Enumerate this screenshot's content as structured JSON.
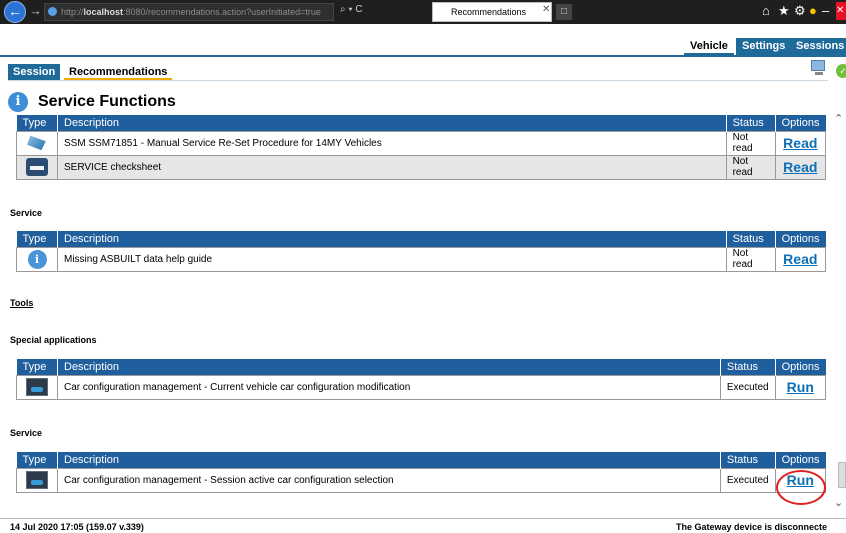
{
  "browser": {
    "url_host": "localhost",
    "url_rest": ":8080/recommendations.action?userInitiated=true",
    "url_prefix": "http://",
    "tab_title": "Recommendations"
  },
  "topnav": {
    "vehicle": "Vehicle",
    "settings": "Settings",
    "sessions": "Sessions"
  },
  "subtabs": {
    "session": "Session",
    "recommendations": "Recommendations"
  },
  "page_title": "Service Functions",
  "table_headers": {
    "type": "Type",
    "description": "Description",
    "status": "Status",
    "options": "Options"
  },
  "sections": {
    "service_functions": {
      "rows": [
        {
          "icon": "ssm-icon",
          "description": "SSM SSM71851 - Manual Service Re-Set Procedure for 14MY Vehicles",
          "status": "Not read",
          "option": "Read"
        },
        {
          "icon": "service-checksheet-icon",
          "description": "SERVICE checksheet",
          "status": "Not read",
          "option": "Read"
        }
      ]
    },
    "service_1": {
      "label": "Service",
      "rows": [
        {
          "icon": "info-icon",
          "description": "Missing ASBUILT data help guide",
          "status": "Not read",
          "option": "Read"
        }
      ]
    },
    "tools": {
      "label": "Tools"
    },
    "special_applications": {
      "label": "Special applications",
      "rows": [
        {
          "icon": "car-config-icon",
          "description": "Car configuration management - Current vehicle car configuration modification",
          "status": "Executed",
          "option": "Run"
        }
      ]
    },
    "service_2": {
      "label": "Service",
      "rows": [
        {
          "icon": "car-config-icon",
          "description": "Car configuration management - Session active car configuration selection",
          "status": "Executed",
          "option": "Run"
        }
      ]
    }
  },
  "footer": {
    "left": "14 Jul 2020 17:05 (159.07 v.339)",
    "right": "The Gateway device is disconnecte"
  },
  "colors": {
    "header_blue": "#1f5f9e",
    "nav_blue": "#1e6b9a",
    "link_blue": "#0d6fb5",
    "annotation_red": "#e02020"
  }
}
